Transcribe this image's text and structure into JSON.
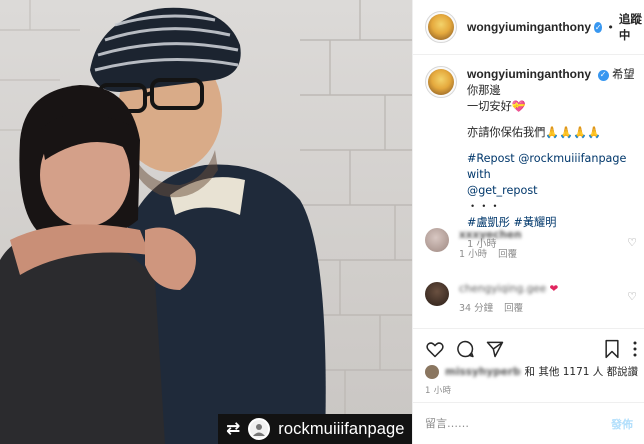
{
  "photo": {
    "repost_badge": {
      "icon": "repost-icon",
      "account": "rockmuiiifanpage"
    }
  },
  "header": {
    "username": "wongyiuminganthony",
    "separator": "•",
    "follow_label": "追蹤中"
  },
  "caption": {
    "username": "wongyiuminganthony",
    "line1": "希望你那邊",
    "line2": "一切安好💝",
    "line3": "亦請你保佑我們🙏🙏🙏🙏",
    "line4": "#Repost @rockmuiiifanpage with",
    "line5": "@get_repost",
    "line6": "・・・",
    "line7": "#盧凱彤 #黃耀明",
    "time": "1 小時"
  },
  "comments": [
    {
      "username": "xxxyechen",
      "time": "1 小時",
      "reply_label": "回覆"
    },
    {
      "username": "chengyiqing.gee",
      "text": "❤",
      "time": "34 分鐘",
      "reply_label": "回覆"
    }
  ],
  "likes": {
    "liker": "missyhyperb",
    "text": "和 其他 1171 人 都說讚"
  },
  "timestamp": "1 小時",
  "comment_box": {
    "placeholder": "留言……",
    "post_label": "發佈"
  },
  "colors": {
    "link": "#00376b",
    "verified": "#3897f0",
    "muted": "#8e8e8e",
    "badge_bg": "#121212"
  }
}
